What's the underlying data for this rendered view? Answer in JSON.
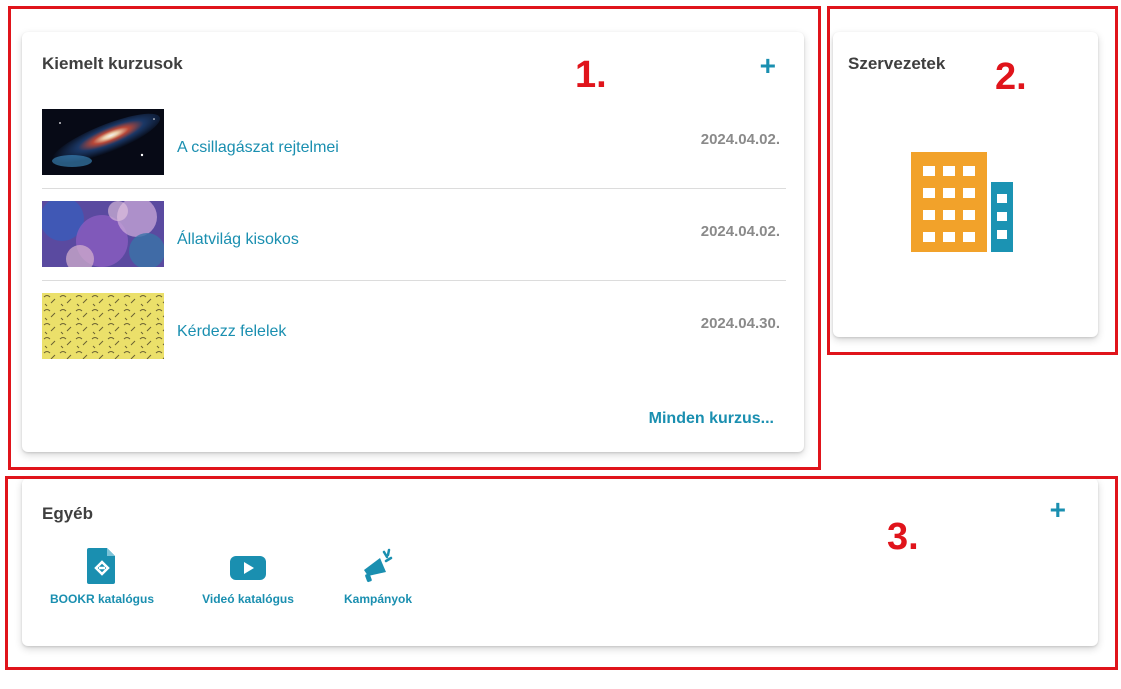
{
  "featured": {
    "title": "Kiemelt kurzusok",
    "add_label": "+",
    "courses": [
      {
        "name": "A csillagászat rejtelmei",
        "date": "2024.04.02."
      },
      {
        "name": "Állatvilág kisokos",
        "date": "2024.04.02."
      },
      {
        "name": "Kérdezz felelek",
        "date": "2024.04.30."
      }
    ],
    "all_link": "Minden kurzus..."
  },
  "organizations": {
    "title": "Szervezetek"
  },
  "other": {
    "title": "Egyéb",
    "add_label": "+",
    "items": [
      {
        "label": "BOOKR katalógus",
        "icon": "ebook-file-icon"
      },
      {
        "label": "Videó katalógus",
        "icon": "video-play-icon"
      },
      {
        "label": "Kampányok",
        "icon": "megaphone-icon"
      }
    ]
  },
  "annotations": [
    "1.",
    "2.",
    "3."
  ],
  "colors": {
    "accent": "#1a8fb0",
    "annotation": "#e0141b",
    "building_orange": "#f2a22a",
    "building_teal": "#1b93b3"
  }
}
